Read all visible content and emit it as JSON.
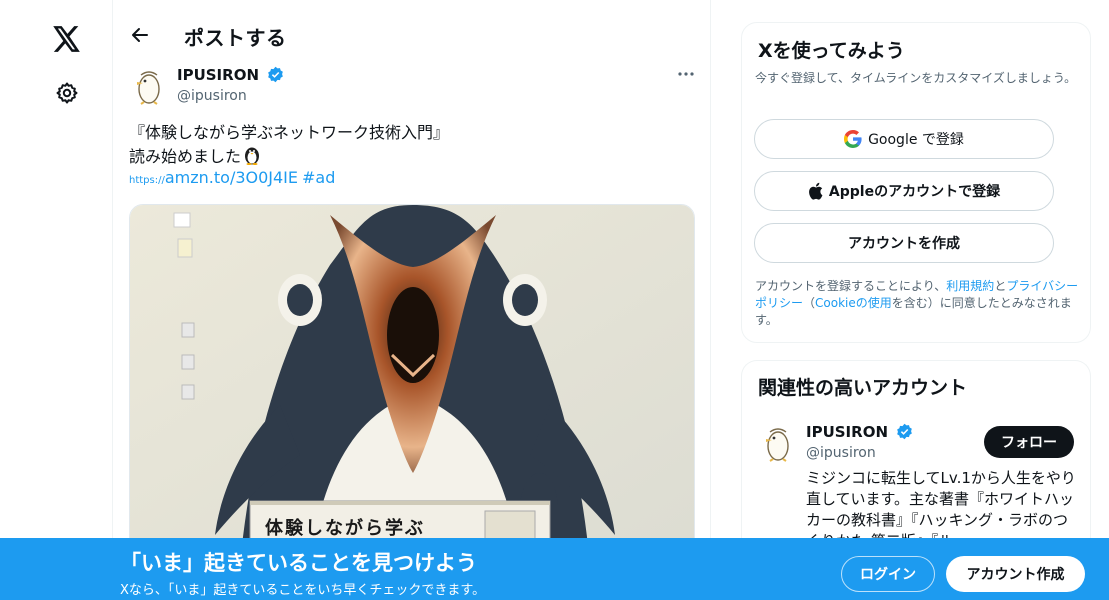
{
  "header": {
    "title": "ポストする"
  },
  "tweet": {
    "author_name": "IPUSIRON",
    "author_handle": "@ipusiron",
    "text_line1": "『体験しながら学ぶネットワーク技術入門』",
    "text_line2": "読み始めました",
    "link_protocol": "https://",
    "link_text": "amzn.to/3O0J4IE",
    "hashtag": "#ad",
    "image_caption": "体験しながら学ぶ"
  },
  "signup_card": {
    "title": "Xを使ってみよう",
    "subtitle": "今すぐ登録して、タイムラインをカスタマイズしましょう。",
    "google_label": "Google で登録",
    "apple_label": "Appleのアカウントで登録",
    "create_label": "アカウントを作成",
    "legal_prefix": "アカウントを登録することにより、",
    "legal_terms": "利用規約",
    "legal_and": "と",
    "legal_privacy": "プライバシーポリシー",
    "legal_open": "（",
    "legal_cookie": "Cookieの使用",
    "legal_suffix": "を含む）に同意したとみなされます。"
  },
  "related_card": {
    "title": "関連性の高いアカウント",
    "name": "IPUSIRON",
    "handle": "@ipusiron",
    "follow_label": "フォロー",
    "bio": "ミジンコに転生してLv.1から人生をやり直しています。主な著書『ホワイトハッカーの教科書』『ハッキング・ラボのつくりかた 第二版』『ル"
  },
  "banner": {
    "title": "「いま」起きていることを見つけよう",
    "subtitle": "Xなら、「いま」起きていることをいち早くチェックできます。",
    "login_label": "ログイン",
    "signup_label": "アカウント作成"
  },
  "colors": {
    "accent": "#1d9bf0",
    "text": "#0f1419",
    "muted": "#536471"
  },
  "icons": [
    "x-logo-icon",
    "gear-icon",
    "back-arrow-icon",
    "verified-badge-icon",
    "more-icon",
    "google-icon",
    "apple-icon",
    "penguin-emoji-icon"
  ]
}
